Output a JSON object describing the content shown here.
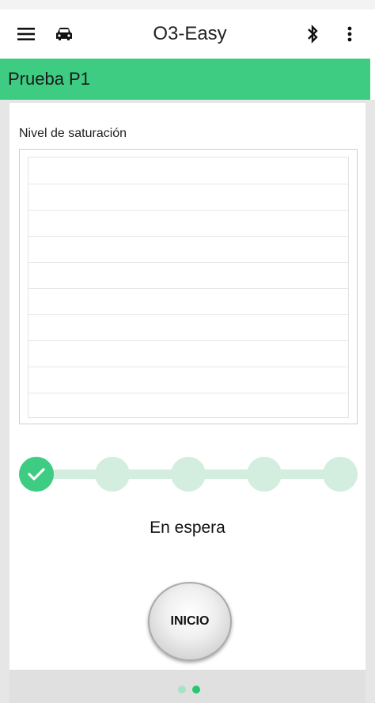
{
  "app": {
    "title": "O3-Easy"
  },
  "icons": {
    "menu": "menu-icon",
    "vehicle": "car-icon",
    "bluetooth": "bluetooth-icon",
    "more": "more-vert-icon",
    "check": "check-icon"
  },
  "colors": {
    "accent": "#3ecb82",
    "step_inactive": "#d3eddf",
    "page_active_dot": "#26c76f"
  },
  "section": {
    "title": "Prueba P1"
  },
  "chart": {
    "label": "Nivel de saturación"
  },
  "chart_data": {
    "type": "line",
    "title": "Nivel de saturación",
    "series": [],
    "grid": true
  },
  "progress": {
    "total_steps": 5,
    "completed_steps": 1
  },
  "status": {
    "text": "En espera"
  },
  "actions": {
    "start_label": "INICIO"
  },
  "pager": {
    "pages": 2,
    "current": 2
  }
}
